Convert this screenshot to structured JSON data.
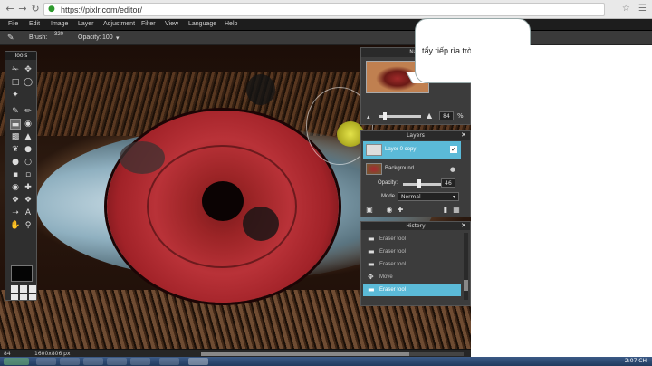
{
  "browser": {
    "url": "https://pixlr.com/editor/",
    "lock_icon": "lock-icon",
    "back_icon": "back-arrow-icon",
    "forward_icon": "forward-arrow-icon",
    "reload_icon": "reload-icon"
  },
  "menubar": {
    "items": [
      "File",
      "Edit",
      "Image",
      "Layer",
      "Adjustment",
      "Filter",
      "View",
      "Language",
      "Help"
    ]
  },
  "options": {
    "brush_label": "Brush:",
    "brush_size": "320",
    "opacity_label": "Opacity:",
    "opacity_value": "100"
  },
  "tools": {
    "title": "Tools",
    "active_tool": "eraser-tool"
  },
  "navigator": {
    "title": "Navi",
    "zoom": "84"
  },
  "layers": {
    "title": "Layers",
    "items": [
      {
        "name": "Layer 0 copy",
        "selected": true,
        "visible": true
      },
      {
        "name": "Background",
        "selected": false,
        "locked": true
      }
    ],
    "opacity_label": "Opacity:",
    "opacity_value": "46",
    "mode_label": "Mode",
    "mode_value": "Normal"
  },
  "history": {
    "title": "History",
    "items": [
      {
        "label": "Eraser tool",
        "active": false
      },
      {
        "label": "Eraser tool",
        "active": false
      },
      {
        "label": "Eraser tool",
        "active": false
      },
      {
        "label": "Move",
        "active": false
      },
      {
        "label": "Eraser tool",
        "active": true
      }
    ]
  },
  "callout": {
    "text": "tẩy tiếp rìa tròng mắt"
  },
  "status": {
    "zoom": "84",
    "size": "1600x806 px"
  },
  "taskbar": {
    "clock": "2:07 CH"
  },
  "colors": {
    "accent": "#5bbad8",
    "panel_bg": "#3c3c3c",
    "iris_red": "#b93238"
  }
}
